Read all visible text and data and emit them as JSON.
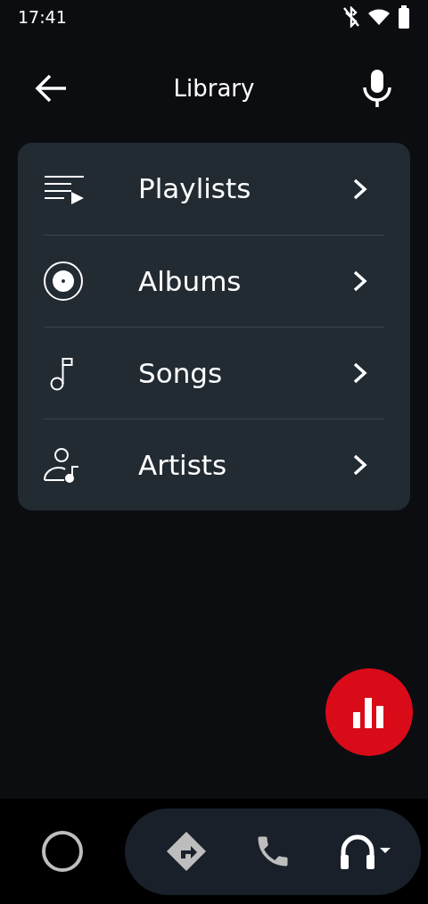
{
  "status_bar": {
    "time": "17:41"
  },
  "header": {
    "title": "Library"
  },
  "library_items": [
    {
      "label": "Playlists",
      "kind": "playlist"
    },
    {
      "label": "Albums",
      "kind": "album"
    },
    {
      "label": "Songs",
      "kind": "song"
    },
    {
      "label": "Artists",
      "kind": "artist"
    }
  ],
  "nav_bar": [
    {
      "kind": "navigation",
      "selected": false
    },
    {
      "kind": "phone",
      "selected": false
    },
    {
      "kind": "media",
      "selected": true
    }
  ]
}
